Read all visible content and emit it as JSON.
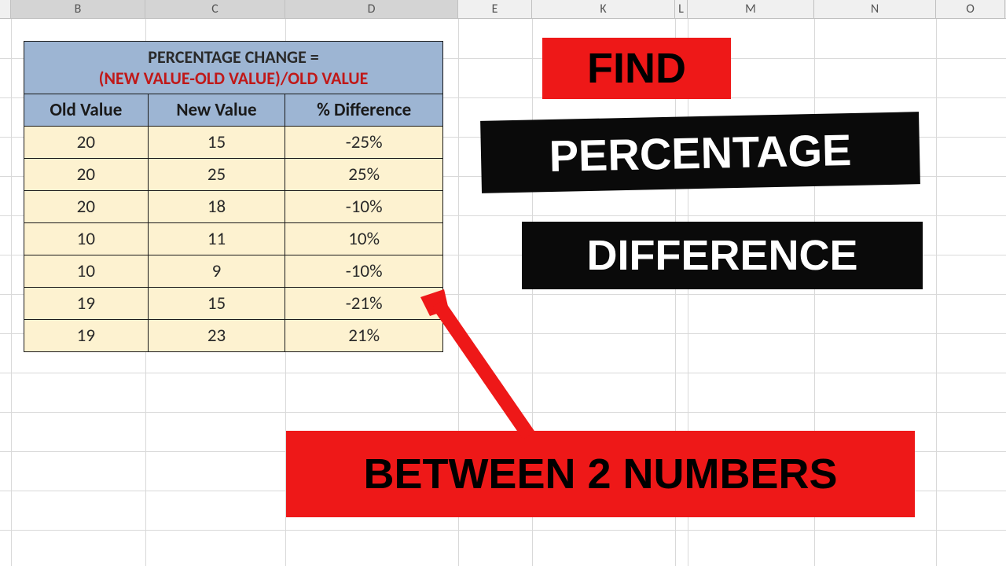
{
  "columns": [
    "B",
    "C",
    "D",
    "E",
    "K",
    "L",
    "M",
    "N",
    "O"
  ],
  "selected_columns": [
    "B",
    "C",
    "D"
  ],
  "title": {
    "line1": "PERCENTAGE CHANGE =",
    "line2": "(NEW VALUE-OLD VALUE)/OLD VALUE"
  },
  "headers": {
    "old": "Old Value",
    "new": "New Value",
    "diff": "% Difference"
  },
  "rows": [
    {
      "old": "20",
      "new": "15",
      "diff": "-25%"
    },
    {
      "old": "20",
      "new": "25",
      "diff": "25%"
    },
    {
      "old": "20",
      "new": "18",
      "diff": "-10%"
    },
    {
      "old": "10",
      "new": "11",
      "diff": "10%"
    },
    {
      "old": "10",
      "new": "9",
      "diff": "-10%"
    },
    {
      "old": "19",
      "new": "15",
      "diff": "-21%"
    },
    {
      "old": "19",
      "new": "23",
      "diff": "21%"
    }
  ],
  "overlays": {
    "find": "FIND",
    "percentage": "PERCENTAGE",
    "difference": "DIFFERENCE",
    "between": "BETWEEN 2 NUMBERS"
  },
  "chart_data": {
    "type": "table",
    "title": "PERCENTAGE CHANGE = (NEW VALUE-OLD VALUE)/OLD VALUE",
    "columns": [
      "Old Value",
      "New Value",
      "% Difference"
    ],
    "rows": [
      [
        20,
        15,
        -0.25
      ],
      [
        20,
        25,
        0.25
      ],
      [
        20,
        18,
        -0.1
      ],
      [
        10,
        11,
        0.1
      ],
      [
        10,
        9,
        -0.1
      ],
      [
        19,
        15,
        -0.21
      ],
      [
        19,
        23,
        0.21
      ]
    ]
  }
}
